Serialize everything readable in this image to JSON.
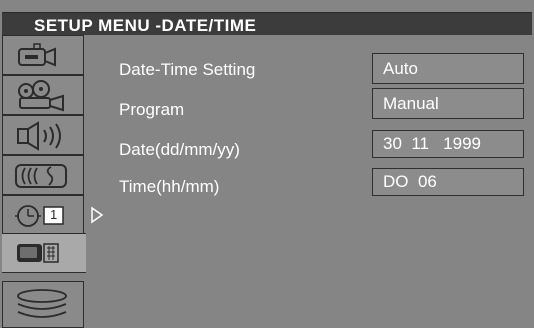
{
  "header": {
    "title": "SETUP MENU -DATE/TIME"
  },
  "sidebar": {
    "items": [
      {
        "icon": "camcorder-icon"
      },
      {
        "icon": "film-camera-icon"
      },
      {
        "icon": "speaker-icon"
      },
      {
        "icon": "audio-wave-icon"
      },
      {
        "icon": "clock-icon",
        "badge": "1",
        "selected": true
      },
      {
        "icon": "tv-remote-icon"
      },
      {
        "icon": "disc-stack-icon"
      }
    ]
  },
  "settings": [
    {
      "label": "Date-Time Setting",
      "value": "Auto"
    },
    {
      "label": "Program",
      "value": "Manual"
    },
    {
      "label": "Date(dd/mm/yy)",
      "value": "30  11   1999"
    },
    {
      "label": "Time(hh/mm)",
      "value": "DO  06"
    }
  ]
}
